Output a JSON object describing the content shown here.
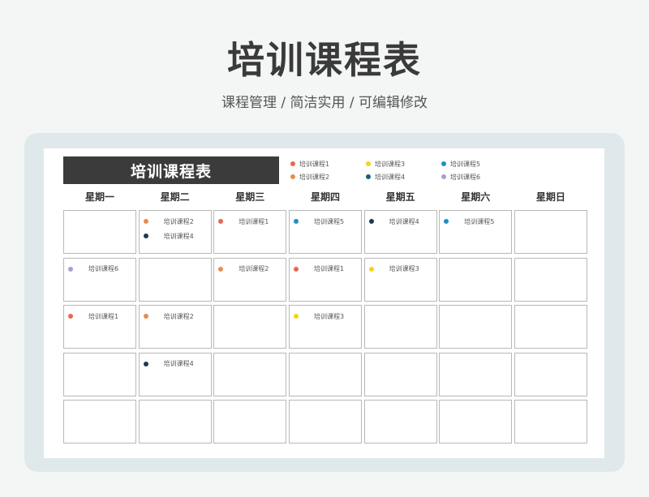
{
  "header": {
    "title": "培训课程表",
    "subtitle": "课程管理 /  简洁实用  /  可编辑修改"
  },
  "sheet": {
    "title": "培训课程表",
    "legend": [
      {
        "label": "培训课程1",
        "color": "#e8674f"
      },
      {
        "label": "培训课程3",
        "color": "#f7d117"
      },
      {
        "label": "培训课程5",
        "color": "#1f8fc4"
      },
      {
        "label": "培训课程2",
        "color": "#e98c4e"
      },
      {
        "label": "培训课程4",
        "color": "#1f5f73"
      },
      {
        "label": "培训课程6",
        "color": "#b09ad6"
      }
    ],
    "weekdays": [
      "星期一",
      "星期二",
      "星期三",
      "星期四",
      "星期五",
      "星期六",
      "星期日"
    ],
    "rows": [
      [
        [],
        [
          {
            "label": "培训课程2",
            "color": "#e98c4e"
          },
          {
            "label": "培训课程4",
            "color": "#1e3a52"
          }
        ],
        [
          {
            "label": "培训课程1",
            "color": "#e8674f"
          }
        ],
        [
          {
            "label": "培训课程5",
            "color": "#1f8fc4"
          }
        ],
        [
          {
            "label": "培训课程4",
            "color": "#1e3a52"
          }
        ],
        [
          {
            "label": "培训课程5",
            "color": "#1f8fc4"
          }
        ],
        []
      ],
      [
        [
          {
            "label": "培训课程6",
            "color": "#b09ad6"
          }
        ],
        [],
        [
          {
            "label": "培训课程2",
            "color": "#e98c4e"
          }
        ],
        [
          {
            "label": "培训课程1",
            "color": "#e8674f"
          }
        ],
        [
          {
            "label": "培训课程3",
            "color": "#f7d117"
          }
        ],
        [],
        []
      ],
      [
        [
          {
            "label": "培训课程1",
            "color": "#e8674f"
          }
        ],
        [
          {
            "label": "培训课程2",
            "color": "#e98c4e"
          }
        ],
        [],
        [
          {
            "label": "培训课程3",
            "color": "#f7d117"
          }
        ],
        [],
        [],
        []
      ],
      [
        [],
        [
          {
            "label": "培训课程4",
            "color": "#1e3a52"
          }
        ],
        [],
        [],
        [],
        [],
        []
      ],
      [
        [],
        [],
        [],
        [],
        [],
        [],
        []
      ]
    ]
  }
}
